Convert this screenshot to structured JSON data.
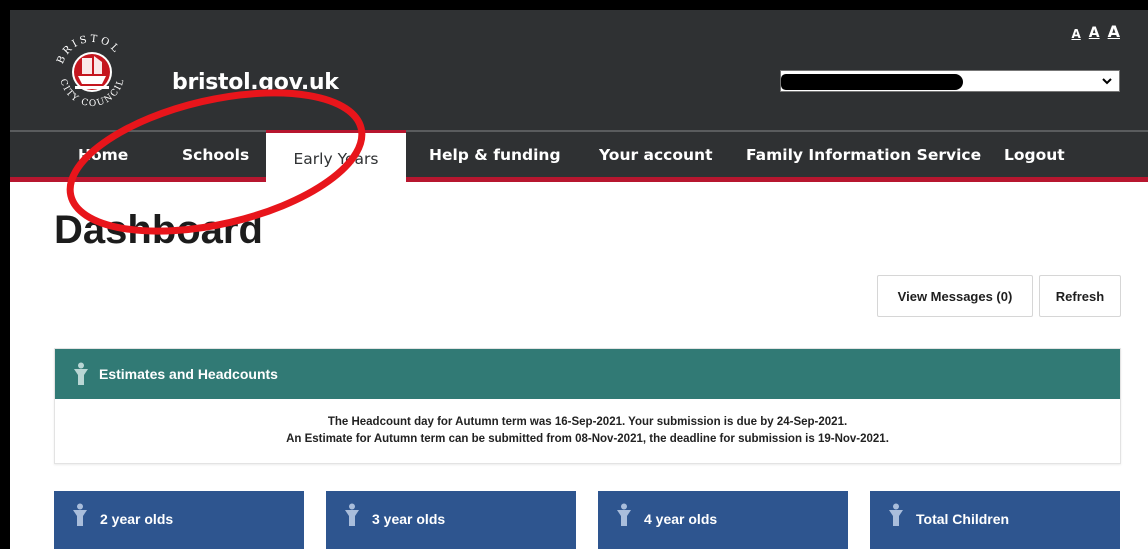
{
  "header": {
    "logo_arc_top": "BRISTOL",
    "logo_arc_bottom": "CITY COUNCIL",
    "site_name": "bristol.gov.uk",
    "text_size": [
      "A",
      "A",
      "A"
    ],
    "account_select": {
      "value": ""
    }
  },
  "nav": {
    "items": [
      {
        "label": "Home"
      },
      {
        "label": "Schools"
      },
      {
        "label": "Early Years",
        "active": true
      },
      {
        "label": "Help & funding"
      },
      {
        "label": "Your account"
      },
      {
        "label": "Family Information Service"
      },
      {
        "label": "Logout"
      }
    ]
  },
  "main": {
    "title": "Dashboard",
    "buttons": {
      "messages": "View Messages (0)",
      "refresh": "Refresh"
    },
    "estimates_panel": {
      "title": "Estimates and Headcounts",
      "lines": [
        "The Headcount day for Autumn term was 16-Sep-2021. Your submission is due by 24-Sep-2021.",
        "An Estimate for Autumn term can be submitted from 08-Nov-2021, the deadline for submission is 19-Nov-2021."
      ]
    },
    "cards": [
      {
        "label": "2 year olds"
      },
      {
        "label": "3 year olds"
      },
      {
        "label": "4 year olds"
      },
      {
        "label": "Total Children"
      }
    ]
  },
  "colors": {
    "header_bg": "#2f3133",
    "nav_accent": "#b7162f",
    "panel_teal": "#317a75",
    "card_blue": "#2e558f",
    "annotation_red": "#e8151b"
  },
  "icons": [
    "bristol-crest-logo",
    "chevron-down-icon",
    "child-icon"
  ]
}
